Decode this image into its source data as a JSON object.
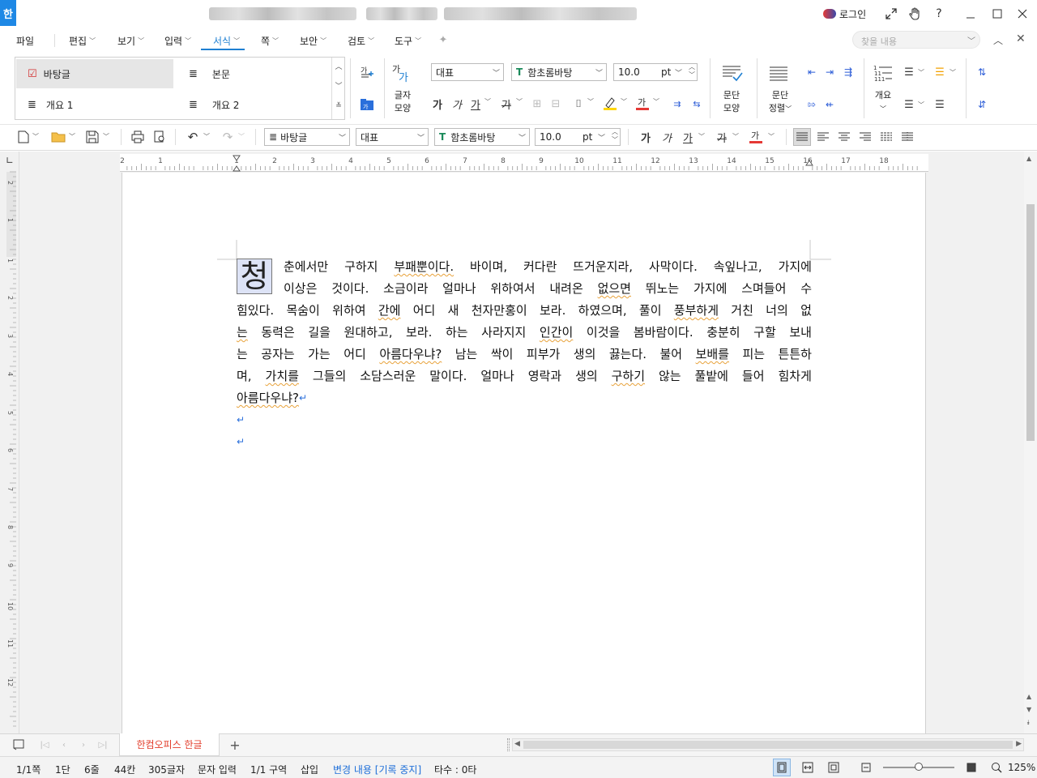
{
  "app": {
    "logo": "한"
  },
  "titlebar": {
    "login_label": "로그인",
    "icons": [
      "restore-fullscreen-icon",
      "hand-icon",
      "help-icon",
      "minimize-icon",
      "maximize-icon",
      "close-icon"
    ]
  },
  "menu": {
    "items": [
      "파일",
      "편집",
      "보기",
      "입력",
      "서식",
      "쪽",
      "보안",
      "검토",
      "도구"
    ],
    "active": "서식",
    "find_placeholder": "찾을 내용"
  },
  "ribbon": {
    "styles": [
      "바탕글",
      "본문",
      "개요 1",
      "개요 2"
    ],
    "style_label_char": "글자\n모양",
    "char_shape": [
      "글자",
      "모양"
    ],
    "font_lang": "대표",
    "font_name": "함초롬바탕",
    "font_size": "10.0",
    "font_unit": "pt",
    "para_shape": [
      "문단",
      "모양"
    ],
    "para_align": [
      "문단",
      "정렬"
    ],
    "outline": "개요",
    "format_glyphs": {
      "bold": "가",
      "italic": "가",
      "underline": "가",
      "strike": "가",
      "color": "가"
    }
  },
  "toolbar2": {
    "style": "바탕글",
    "font_lang": "대표",
    "font_name": "함초롬바탕",
    "font_size": "10.0",
    "font_unit": "pt"
  },
  "ruler": {
    "h_ticks": [
      "2",
      "1",
      "",
      "1",
      "2",
      "3",
      "4",
      "5",
      "6",
      "7",
      "8",
      "9",
      "10",
      "11",
      "12",
      "13",
      "14",
      "15",
      "16",
      "17",
      "18"
    ],
    "v_ticks": [
      "2",
      "1",
      "1",
      "2",
      "3",
      "4",
      "5",
      "6",
      "7",
      "8",
      "9",
      "10",
      "11",
      "12"
    ]
  },
  "document": {
    "dropcap": "청",
    "lines": [
      "춘에서만 구하지 부패뿐이다. 바이며, 커다란 뜨거운지라, 사막이다. 속잎나고, 가지에",
      "이상은 것이다. 소금이라 얼마나 위하여서 내려온 없으면 뛰노는 가지에 스며들어 수",
      "힘있다. 목숨이 위하여 간에 어디 새 천자만홍이 보라. 하였으며, 풀이 풍부하게 거친 너의 없",
      "는 동력은 길을 원대하고, 보라. 하는 사라지지 인간이 이것을 봄바람이다. 충분히 구할 보내",
      "는 공자는 가는 어디 아름다우냐? 남는 싹이 피부가 생의 끓는다. 불어 보배를 피는 튼튼하",
      "며, 가치를 그들의 소담스러운 말이다. 얼마나 영락과 생의 구하기 않는 풀밭에 들어 힘차게",
      "아름다우냐?"
    ],
    "return_mark": "↵"
  },
  "tabs": {
    "doc_tab": "한컴오피스 한글",
    "add": "+"
  },
  "statusbar": {
    "page": "1/1쪽",
    "column": "1단",
    "line": "6줄",
    "col": "44칸",
    "chars": "305글자",
    "mode": "문자 입력",
    "section": "1/1 구역",
    "insert": "삽입",
    "track": "변경 내용 [기록 중지]",
    "typing": "타수 : 0타",
    "zoom": "125%",
    "zoom_level": 0.5,
    "track_color": "#1e6fd9"
  }
}
